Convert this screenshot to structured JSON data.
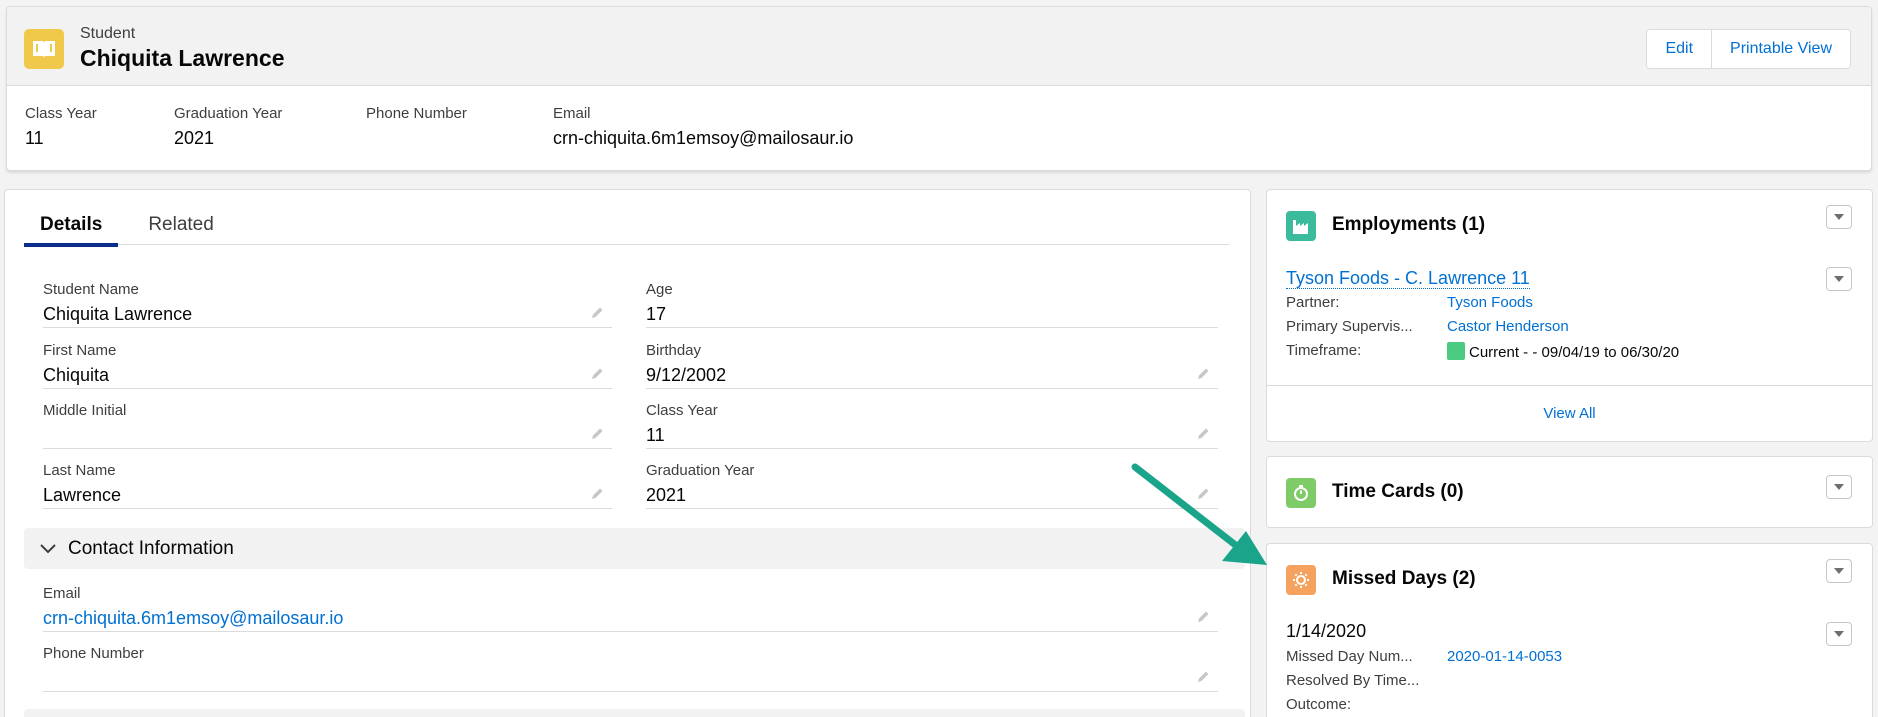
{
  "header": {
    "object_type": "Student",
    "record_name": "Chiquita Lawrence",
    "edit_label": "Edit",
    "printable_label": "Printable View",
    "icon": "student-book-icon",
    "icon_color": "#f0c94a"
  },
  "highlights": [
    {
      "label": "Class Year",
      "value": "11"
    },
    {
      "label": "Graduation Year",
      "value": "2021"
    },
    {
      "label": "Phone Number",
      "value": ""
    },
    {
      "label": "Email",
      "value": "crn-chiquita.6m1emsoy@mailosaur.io"
    }
  ],
  "tabs": [
    {
      "label": "Details",
      "active": true
    },
    {
      "label": "Related",
      "active": false
    }
  ],
  "fields": {
    "student_name": {
      "label": "Student Name",
      "value": "Chiquita Lawrence"
    },
    "first_name": {
      "label": "First Name",
      "value": "Chiquita"
    },
    "middle_initial": {
      "label": "Middle Initial",
      "value": ""
    },
    "last_name": {
      "label": "Last Name",
      "value": "Lawrence"
    },
    "age": {
      "label": "Age",
      "value": "17"
    },
    "birthday": {
      "label": "Birthday",
      "value": "9/12/2002"
    },
    "class_year": {
      "label": "Class Year",
      "value": "11"
    },
    "graduation_year": {
      "label": "Graduation Year",
      "value": "2021"
    }
  },
  "contact_section": {
    "title": "Contact Information",
    "email": {
      "label": "Email",
      "value": "crn-chiquita.6m1emsoy@mailosaur.io"
    },
    "phone": {
      "label": "Phone Number",
      "value": ""
    }
  },
  "employments": {
    "title": "Employments (1)",
    "icon_color": "#3bba9c",
    "item_title": "Tyson Foods - C. Lawrence 11",
    "partner_label": "Partner:",
    "partner_value": "Tyson Foods",
    "supervisor_label": "Primary Supervis...",
    "supervisor_value": "Castor Henderson",
    "timeframe_label": "Timeframe:",
    "timeframe_value": "Current - - 09/04/19 to 06/30/20",
    "view_all": "View All"
  },
  "time_cards": {
    "title": "Time Cards (0)",
    "icon_color": "#7ecb67"
  },
  "missed_days": {
    "title": "Missed Days (2)",
    "icon_color": "#f4a25d",
    "item_title": "1/14/2020",
    "number_label": "Missed Day Num...",
    "number_value": "2020-01-14-0053",
    "resolved_label": "Resolved By Time...",
    "outcome_label": "Outcome:"
  },
  "annotation_arrow_color": "#1aa58b"
}
